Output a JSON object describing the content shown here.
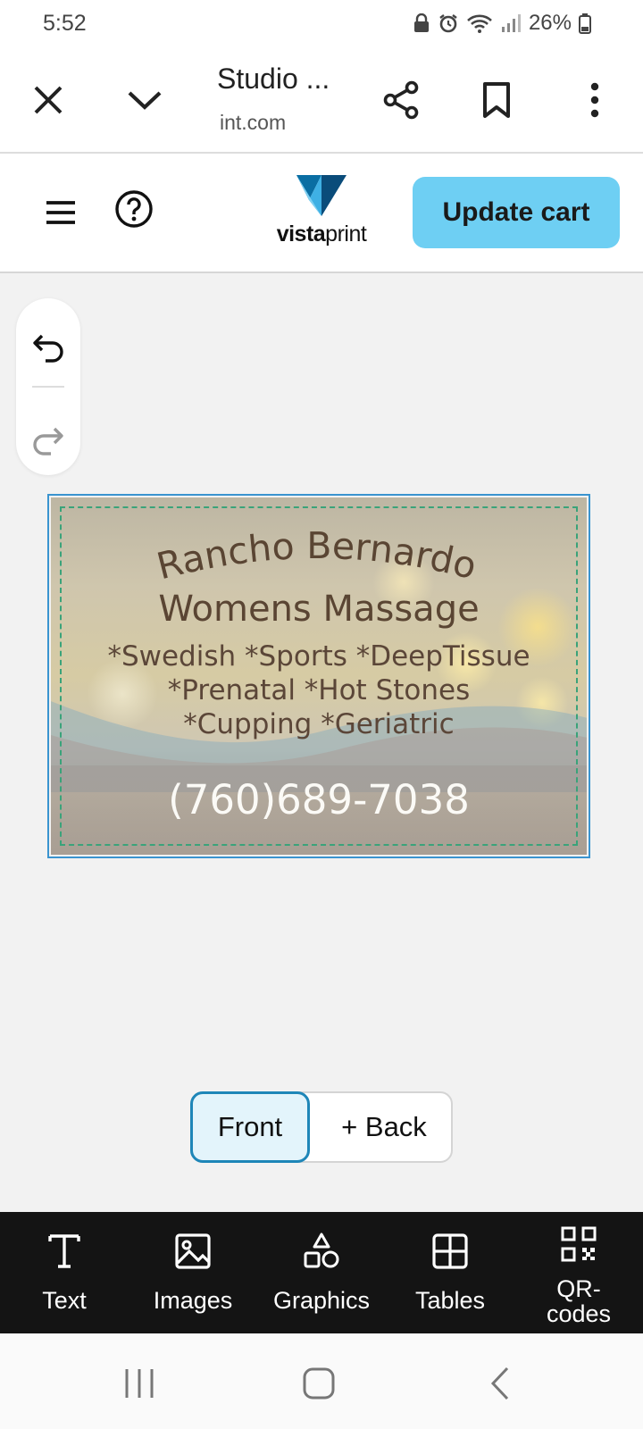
{
  "status_bar": {
    "time": "5:52",
    "battery": "26%"
  },
  "browser": {
    "title": "Studio ...",
    "url": "int.com"
  },
  "header": {
    "logo_text_bold": "vista",
    "logo_text_light": "print",
    "update_cart_label": "Update cart"
  },
  "card": {
    "line1": "Rancho Bernardo",
    "line2": "Womens Massage",
    "services": [
      "*Swedish *Sports *DeepTissue",
      "*Prenatal *Hot Stones",
      "*Cupping *Geriatric"
    ],
    "phone": "(760)689-7038"
  },
  "sides": {
    "front": "Front",
    "back": "+ Back",
    "selected": "Front"
  },
  "toolbar": {
    "text": "Text",
    "images": "Images",
    "graphics": "Graphics",
    "tables": "Tables",
    "qr_line1": "QR-",
    "qr_line2": "codes"
  },
  "colors": {
    "accent": "#6ecff3",
    "selected_border": "#1e86b8",
    "toolbar_bg": "#141414"
  }
}
